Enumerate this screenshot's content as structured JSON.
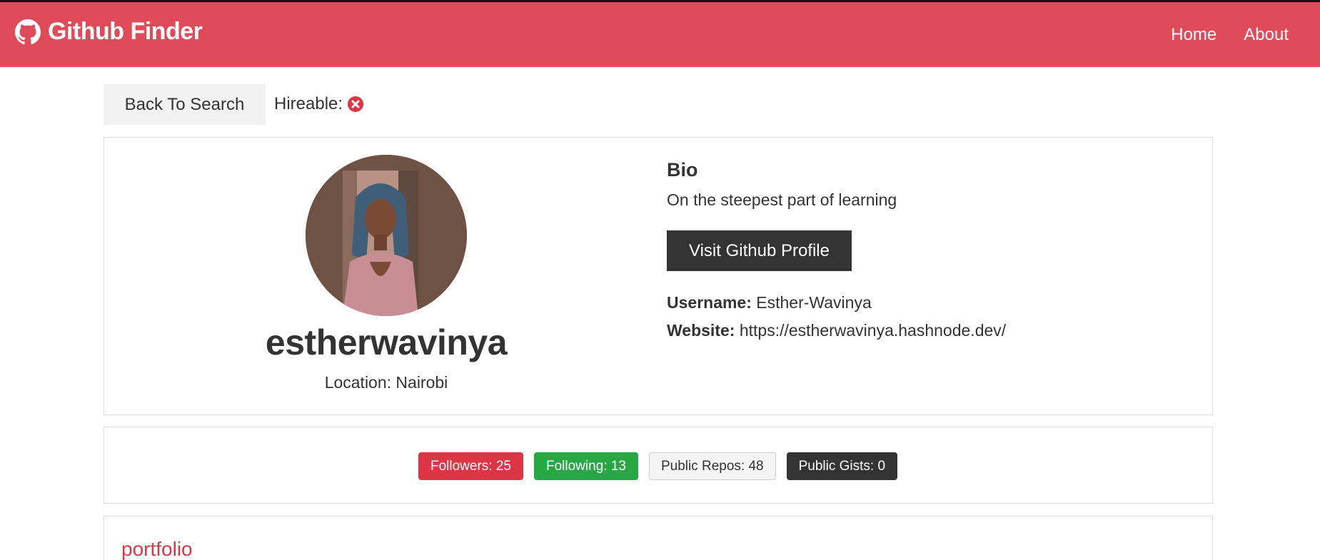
{
  "navbar": {
    "brand_title": "Github Finder",
    "brand_icon": "github-icon",
    "links": [
      "Home",
      "About"
    ]
  },
  "toolbar": {
    "back_label": "Back To Search",
    "hireable_label": "Hireable:",
    "hireable_icon": "times-circle-icon"
  },
  "profile": {
    "login": "estherwavinya",
    "location": "Location: Nairobi",
    "bio_title": "Bio",
    "bio": "On the steepest part of learning",
    "visit_label": "Visit Github Profile",
    "username_label": "Username:",
    "username": "Esther-Wavinya",
    "website_label": "Website:",
    "website": "https://estherwavinya.hashnode.dev/"
  },
  "stats": {
    "followers": "Followers: 25",
    "following": "Following: 13",
    "public_repos": "Public Repos: 48",
    "public_gists": "Public Gists: 0"
  },
  "repos": {
    "first": "portfolio"
  },
  "colors": {
    "navbar": "#e04b5a",
    "danger": "#dc3545",
    "success": "#28a745",
    "dark": "#333333",
    "light": "#f4f4f4"
  }
}
